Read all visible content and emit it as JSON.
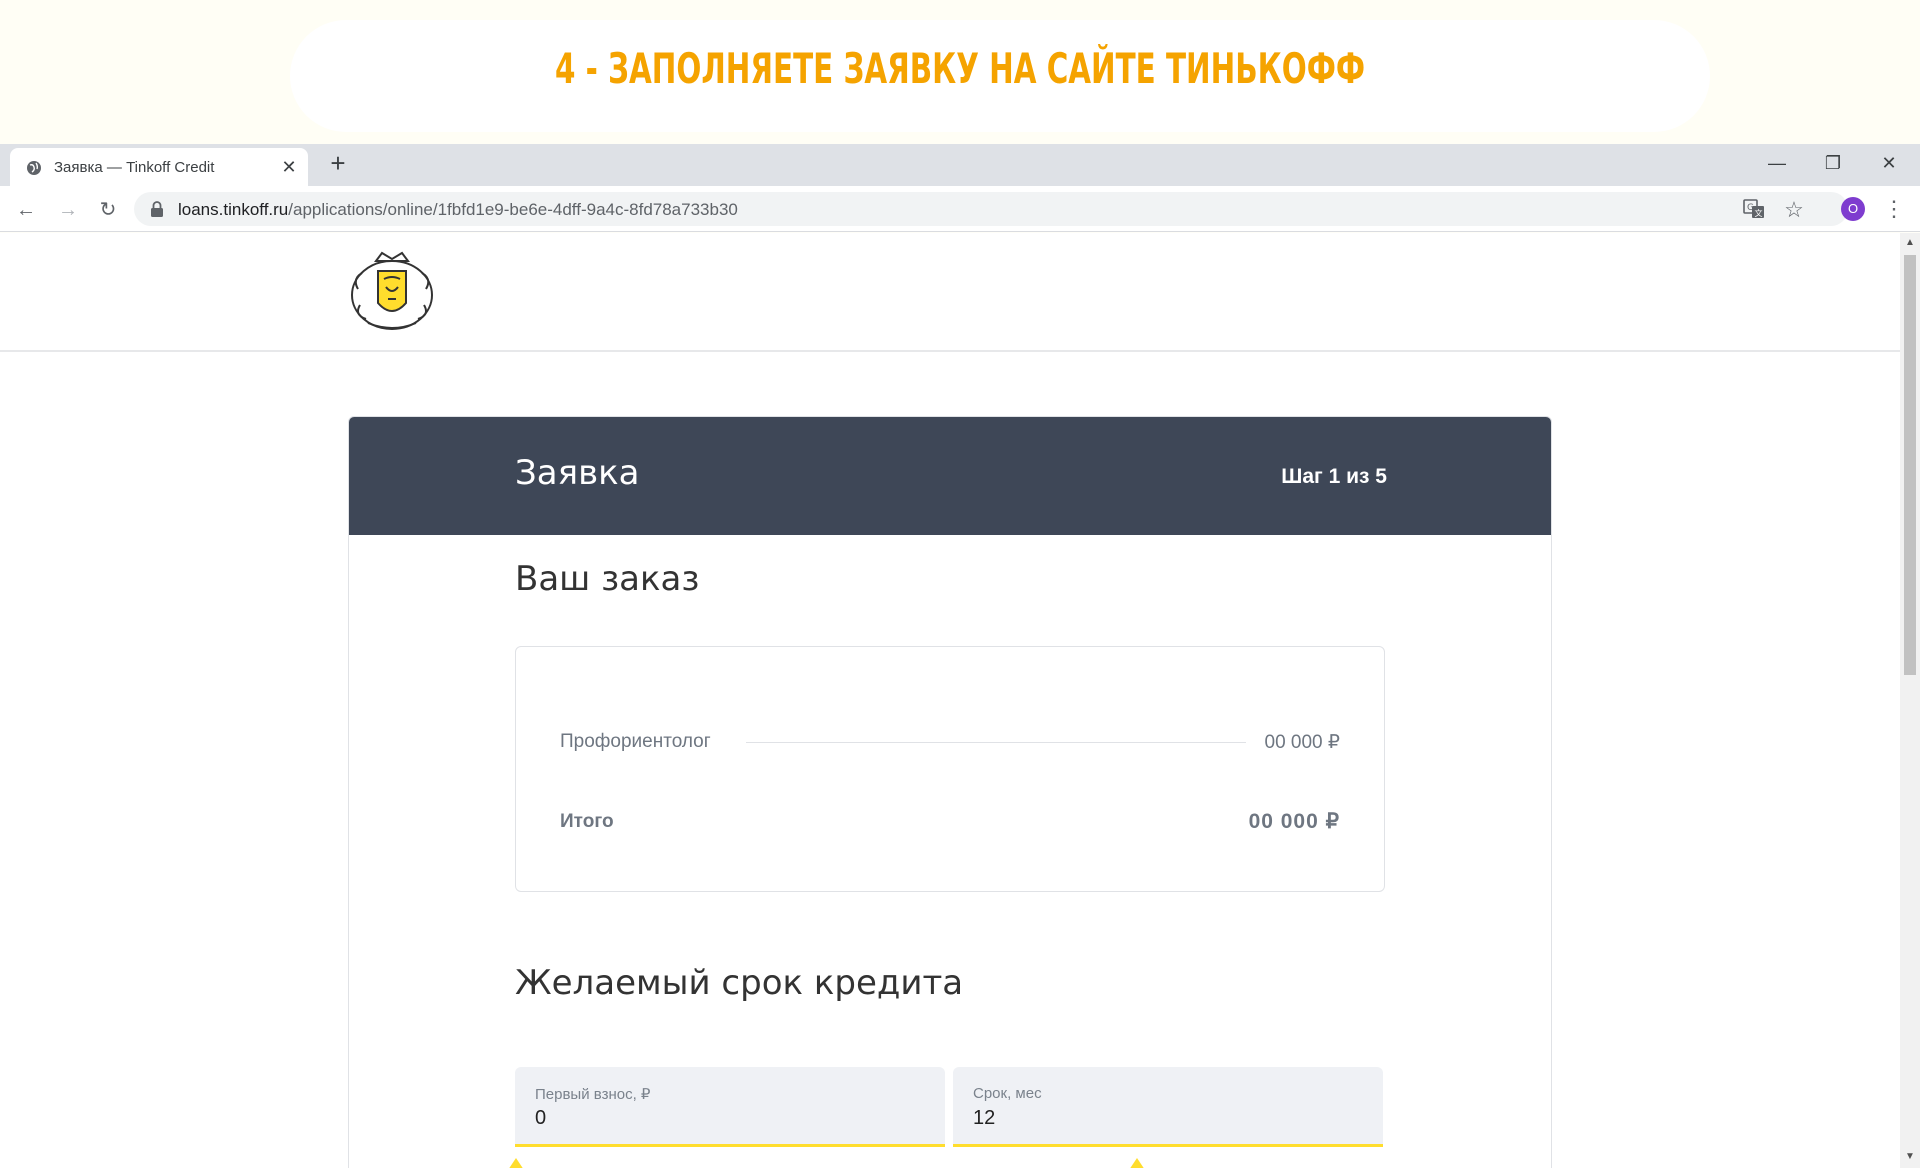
{
  "banner": {
    "title": "4 - ЗАПОЛНЯЕТЕ ЗАЯВКУ НА САЙТЕ ТИНЬКОФФ"
  },
  "browser": {
    "tab_title": "Заявка — Tinkoff Credit",
    "tab_close": "✕",
    "new_tab": "+",
    "window_minimize": "—",
    "window_restore": "❐",
    "window_close": "✕",
    "back": "←",
    "forward": "→",
    "reload": "↻",
    "url_host": "loans.tinkoff.ru",
    "url_path": "/applications/online/1fbfd1e9-be6e-4dff-9a4c-8fd78a733b30",
    "translate_icon": "translate-icon",
    "star": "☆",
    "profile_initial": "O",
    "menu": "⋮"
  },
  "page": {
    "card": {
      "title": "Заявка",
      "step": "Шаг 1 из 5"
    },
    "order": {
      "section_title": "Ваш заказ",
      "item_name": "Профориентолог",
      "item_price": "00 000 ₽",
      "total_label": "Итого",
      "total_value": "00 000 ₽"
    },
    "term": {
      "section_title": "Желаемый срок кредита",
      "down_payment_label": "Первый взнос, ₽",
      "down_payment_value": "0",
      "term_label": "Срок, мес",
      "term_value": "12"
    }
  },
  "colors": {
    "accent": "#ffdd2d",
    "banner_title": "#f5a300",
    "card_header": "#3e4757"
  }
}
